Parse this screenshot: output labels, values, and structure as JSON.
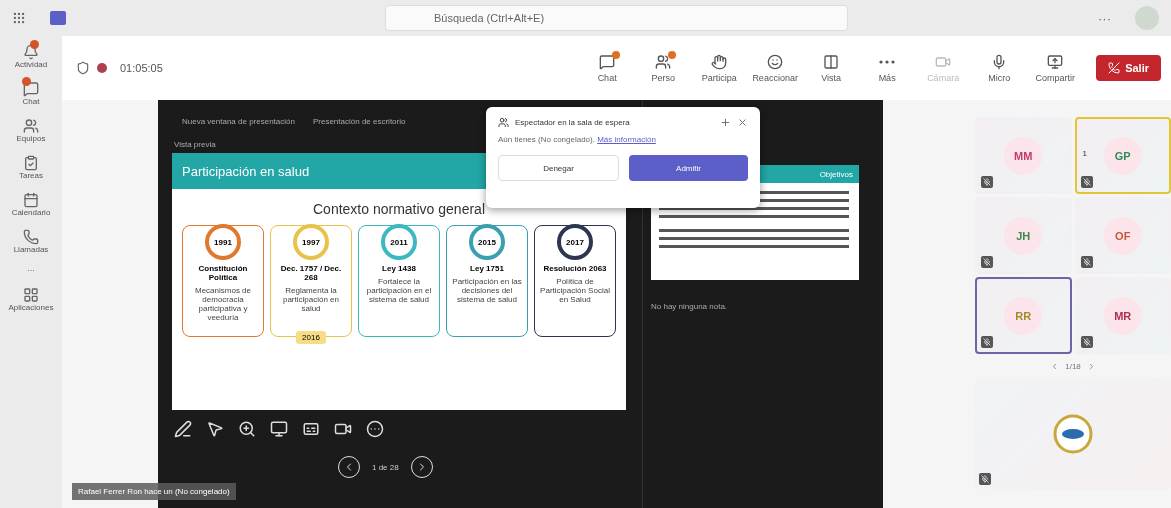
{
  "top_bar": {
    "search": {
      "placeholder": "Búsqueda (Ctrl+Alt+E)"
    },
    "more": "···"
  },
  "sidebar": {
    "items": [
      {
        "label": "Actividad",
        "notification": true
      },
      {
        "label": "Chat",
        "notification": true
      },
      {
        "label": "Equipos",
        "notification": false
      },
      {
        "label": "Tareas",
        "notification": false
      },
      {
        "label": "Calendario",
        "notification": false
      },
      {
        "label": "Llamadas",
        "notification": false
      },
      {
        "label": "···",
        "notification": false
      },
      {
        "label": "Aplicaciones",
        "notification": false
      }
    ]
  },
  "meeting": {
    "timer": "01:05:05",
    "toolbar": [
      {
        "label": "Chat",
        "notification": true,
        "disabled": false
      },
      {
        "label": "Perso",
        "notification": true,
        "disabled": false
      },
      {
        "label": "Participa",
        "notification": false,
        "disabled": false
      },
      {
        "label": "Reaccionar",
        "notification": false,
        "disabled": false
      },
      {
        "label": "Vista",
        "notification": false,
        "disabled": false
      },
      {
        "label": "Más",
        "notification": false,
        "disabled": false
      },
      {
        "label": "Cámara",
        "notification": false,
        "disabled": true
      },
      {
        "label": "Micro",
        "notification": false,
        "disabled": false
      },
      {
        "label": "Compartir",
        "notification": false,
        "disabled": false
      }
    ],
    "leave": "Salir"
  },
  "presentation": {
    "tabs": [
      "Nueva ventana de presentación",
      "Presentación de escritorio"
    ],
    "slide_label": "Vista previa",
    "slide": {
      "title": "Participación en salud",
      "heading": "Contexto normativo general",
      "cards": [
        {
          "year": "1991",
          "title": "Constitución Política",
          "text": "Mecanismos de democracia participativa y veeduría",
          "color": "#e0782e"
        },
        {
          "year": "1997",
          "title": "Dec. 1757 / Dec. 268",
          "text": "Reglamenta la participación en salud",
          "color": "#e8c24a",
          "tag": "2016"
        },
        {
          "year": "2011",
          "title": "Ley 1438",
          "text": "Fortalece la participación en el sistema de salud",
          "color": "#3cb8c0"
        },
        {
          "year": "2015",
          "title": "Ley 1751",
          "text": "Participación en las decisiones del sistema de salud",
          "color": "#3a9fb0"
        },
        {
          "year": "2017",
          "title": "Resolución 2063",
          "text": "Política de Participación Social en Salud",
          "color": "#2e3550"
        }
      ]
    },
    "nav": {
      "page": "1 de 28"
    },
    "notes": {
      "thumbnail_title": "Objetivos",
      "empty": "No hay ninguna nota."
    }
  },
  "lobby_popup": {
    "title": "Espectador en la sala de espera",
    "text": "Aún tienes (No congelado).",
    "link": "Más información",
    "buttons": [
      {
        "label": "Denegar",
        "primary": false
      },
      {
        "label": "Admitir",
        "primary": true
      }
    ]
  },
  "caption": "Rafael Ferrer Ron hace un (No congelado)",
  "participants": [
    {
      "initials": "MM",
      "color": "#c23a6a",
      "speaking": false,
      "pinned": false
    },
    {
      "initials": "GP",
      "color": "#2e8a5a",
      "speaking": true,
      "pinned": false,
      "hand": "1"
    },
    {
      "initials": "JH",
      "color": "#3f8a4a",
      "speaking": false,
      "pinned": false
    },
    {
      "initials": "OF",
      "color": "#c45a3a",
      "speaking": false,
      "pinned": false
    },
    {
      "initials": "RR",
      "color": "#a08a2a",
      "speaking": false,
      "pinned": true
    },
    {
      "initials": "MR",
      "color": "#b03050",
      "speaking": false,
      "pinned": false
    }
  ],
  "gallery_pager": "1/18"
}
